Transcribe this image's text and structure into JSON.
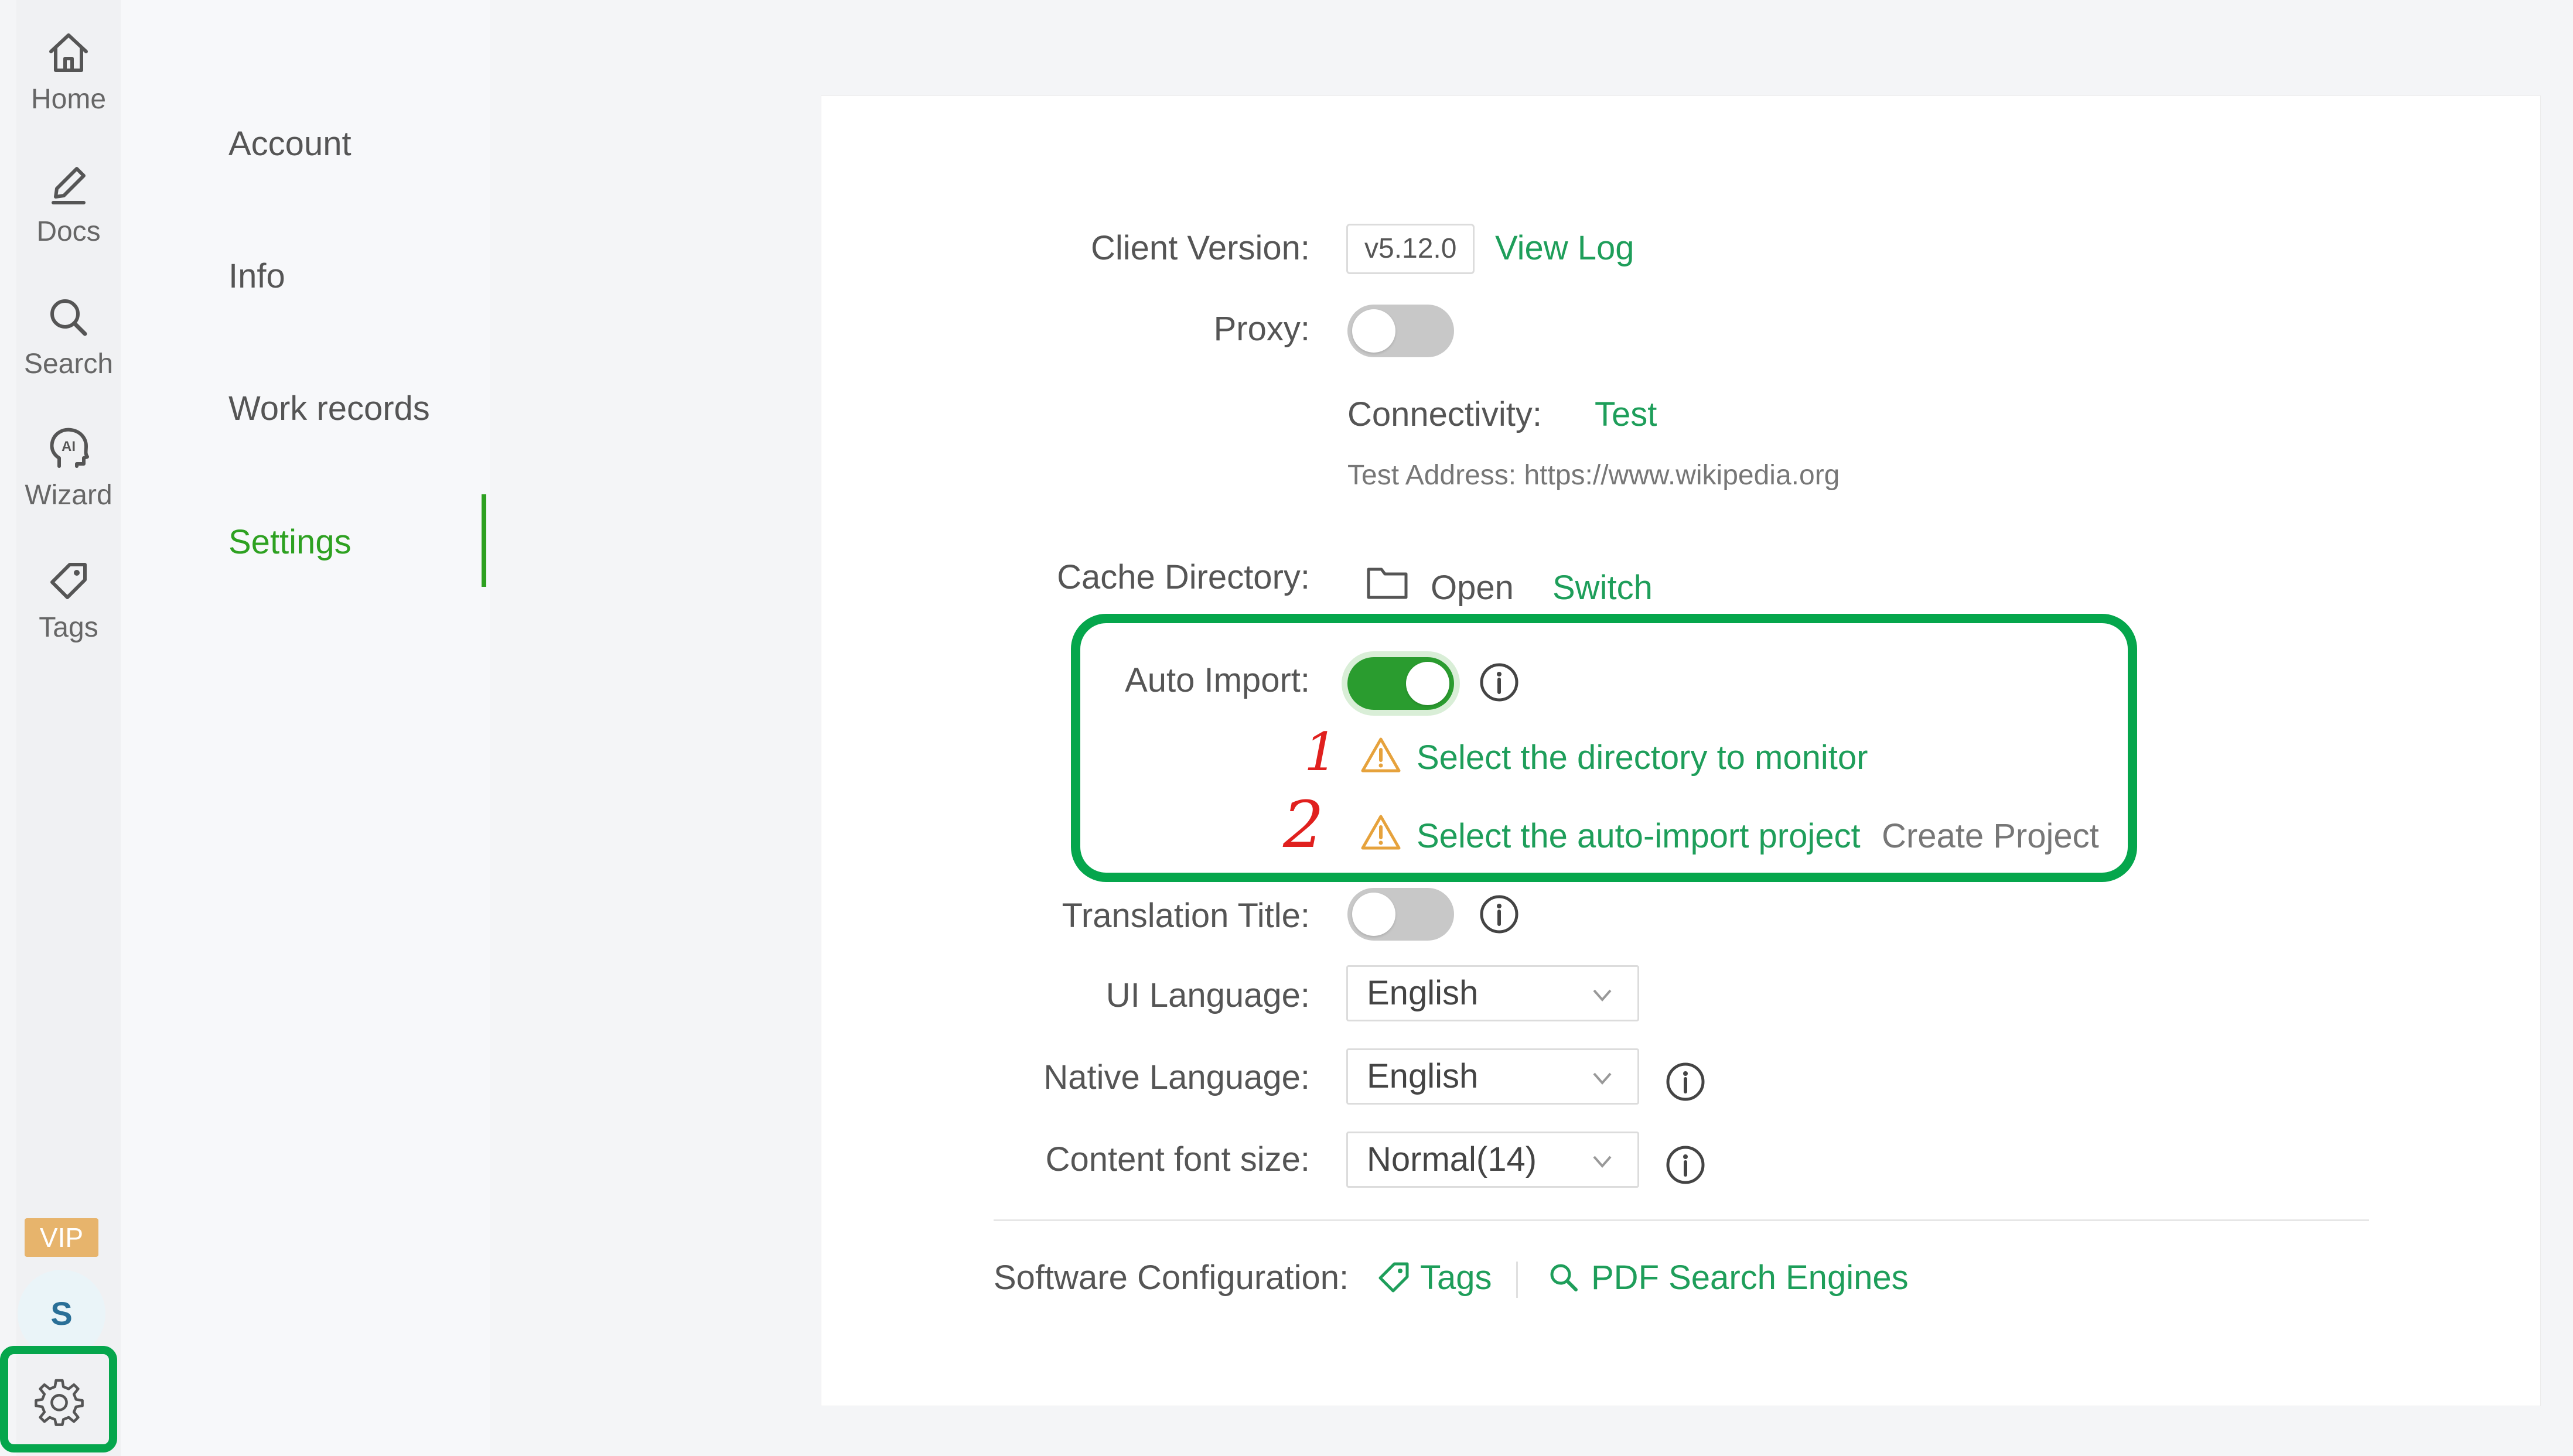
{
  "rail": {
    "items": [
      {
        "label": "Home",
        "icon": "home-icon"
      },
      {
        "label": "Docs",
        "icon": "pen-icon"
      },
      {
        "label": "Search",
        "icon": "search-icon"
      },
      {
        "label": "Wizard",
        "icon": "ai-head-icon"
      },
      {
        "label": "Tags",
        "icon": "tag-icon"
      }
    ],
    "vip_label": "VIP",
    "avatar_initial": "S",
    "settings_icon": "gear-icon"
  },
  "subnav": {
    "items": [
      {
        "label": "Account"
      },
      {
        "label": "Info"
      },
      {
        "label": "Work records"
      },
      {
        "label": "Settings",
        "active": true
      }
    ]
  },
  "settings": {
    "client_version_label": "Client Version:",
    "client_version_value": "v5.12.0",
    "view_log": "View Log",
    "proxy_label": "Proxy:",
    "proxy_on": false,
    "connectivity_label": "Connectivity:",
    "connectivity_test": "Test",
    "test_address": "Test Address: https://www.wikipedia.org",
    "cache_label": "Cache Directory:",
    "cache_open": "Open",
    "cache_switch": "Switch",
    "auto_import_label": "Auto Import:",
    "auto_import_on": true,
    "warn_1": "Select the directory to monitor",
    "warn_2": "Select the auto-import project",
    "create_project": "Create Project",
    "annotation_1": "1",
    "annotation_2": "2",
    "translation_title_label": "Translation Title:",
    "translation_title_on": false,
    "ui_language_label": "UI Language:",
    "ui_language_value": "English",
    "native_language_label": "Native Language:",
    "native_language_value": "English",
    "font_size_label": "Content font size:",
    "font_size_value": "Normal(14)",
    "software_config_label": "Software Configuration:",
    "config_tags": "Tags",
    "config_pdf": "PDF Search Engines"
  },
  "colors": {
    "accent": "#2ea121",
    "link": "#1e9e5a",
    "highlight": "#05a64c",
    "annotation": "#e0201e",
    "warning": "#e6a23c"
  }
}
